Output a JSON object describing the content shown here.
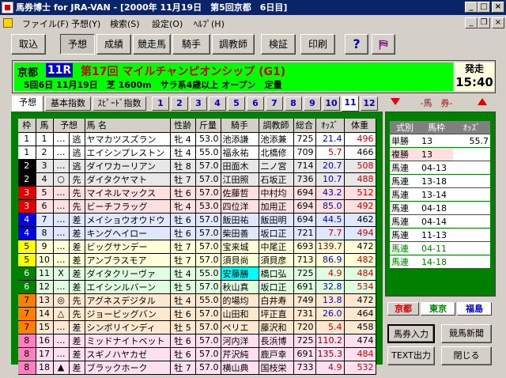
{
  "window": {
    "title": "馬券博士 for JRA-VAN - [2000年 11月19日　第5回京都　6日目]"
  },
  "menu": [
    "ファイル(F)",
    "予想(Y)",
    "検索(S)",
    "設定(O)",
    "ﾍﾙﾌﾟ(H)"
  ],
  "toolbar": [
    "取込",
    "予想",
    "成績",
    "競走馬",
    "騎手",
    "調教師",
    "検証",
    "印刷"
  ],
  "race": {
    "venue": "京都",
    "number": "11R",
    "name": "第17回 マイルチャンピオンシップ (G1)",
    "conditions": "5回6日 11月19日　芝 1600m　サラ系4歳以上 オープン　定量",
    "post_label": "発走",
    "post_time": "15:40"
  },
  "tabs": [
    "予想",
    "基本指数",
    "ｽﾋﾟｰﾄﾞ指数"
  ],
  "race_tabs": [
    "1",
    "2",
    "3",
    "4",
    "5",
    "6",
    "7",
    "8",
    "9",
    "10",
    "11",
    "12"
  ],
  "columns": [
    "枠",
    "馬",
    "予想",
    "馬 名",
    "性齢",
    "斤量",
    "騎手",
    "調教師",
    "総合",
    "ｵｯｽﾞ",
    "体重"
  ],
  "horses": [
    {
      "waku": "1",
      "uma": "1",
      "mark": "…",
      "style": "逃",
      "name": "ヤマカツスズラン",
      "sex": "牝 4",
      "weight": "53.0",
      "jockey": "池添謙",
      "trainer": "池添兼",
      "score": "725",
      "odds": "21.4",
      "body": "496"
    },
    {
      "waku": "1",
      "uma": "2",
      "mark": "…",
      "style": "逃",
      "name": "エイシンプレストン",
      "sex": "牡 4",
      "weight": "55.0",
      "jockey": "福永祐",
      "trainer": "北橋修",
      "score": "709",
      "odds": "5.7",
      "body": "466"
    },
    {
      "waku": "2",
      "uma": "3",
      "mark": "…",
      "style": "逃",
      "name": "ダイワカーリアン",
      "sex": "牡 8",
      "weight": "57.0",
      "jockey": "田面木",
      "trainer": "二ノ宮",
      "score": "714",
      "odds": "20.7",
      "body": "508"
    },
    {
      "waku": "2",
      "uma": "4",
      "mark": "○",
      "style": "先",
      "name": "ダイタクヤマト",
      "sex": "牡 7",
      "weight": "57.0",
      "jockey": "江田照",
      "trainer": "石坂正",
      "score": "736",
      "odds": "10.7",
      "body": "488"
    },
    {
      "waku": "3",
      "uma": "5",
      "mark": "…",
      "style": "先",
      "name": "マイネルマックス",
      "sex": "牡 6",
      "weight": "57.0",
      "jockey": "佐藤哲",
      "trainer": "中村均",
      "score": "694",
      "odds": "43.2",
      "body": "512"
    },
    {
      "waku": "3",
      "uma": "6",
      "mark": "…",
      "style": "先",
      "name": "ビーチフラッグ",
      "sex": "牝 4",
      "weight": "53.0",
      "jockey": "四位洋",
      "trainer": "加用正",
      "score": "694",
      "odds": "85.0",
      "body": "492"
    },
    {
      "waku": "4",
      "uma": "7",
      "mark": "…",
      "style": "差",
      "name": "メイショウオウドウ",
      "sex": "牡 6",
      "weight": "57.0",
      "jockey": "飯田祐",
      "trainer": "飯田明",
      "score": "694",
      "odds": "44.5",
      "body": "462"
    },
    {
      "waku": "4",
      "uma": "8",
      "mark": "…",
      "style": "差",
      "name": "キングヘイロー",
      "sex": "牡 6",
      "weight": "57.0",
      "jockey": "柴田善",
      "trainer": "坂口正",
      "score": "721",
      "odds": "7.7",
      "body": "494"
    },
    {
      "waku": "5",
      "uma": "9",
      "mark": "…",
      "style": "差",
      "name": "ビッグサンデー",
      "sex": "牡 7",
      "weight": "57.0",
      "jockey": "宝来城",
      "trainer": "中尾正",
      "score": "693",
      "odds": "139.7",
      "body": "472"
    },
    {
      "waku": "5",
      "uma": "10",
      "mark": "…",
      "style": "差",
      "name": "アンブラスモア",
      "sex": "牡 7",
      "weight": "57.0",
      "jockey": "須貝尚",
      "trainer": "須貝彦",
      "score": "713",
      "odds": "86.9",
      "body": "482"
    },
    {
      "waku": "6",
      "uma": "11",
      "mark": "X",
      "style": "差",
      "name": "ダイタクリーヴァ",
      "sex": "牡 4",
      "weight": "55.0",
      "jockey": "安藤勝",
      "trainer": "橋口弘",
      "score": "725",
      "odds": "4.9",
      "body": "484"
    },
    {
      "waku": "6",
      "uma": "12",
      "mark": "…",
      "style": "差",
      "name": "エイシンルバーン",
      "sex": "牡 5",
      "weight": "57.0",
      "jockey": "秋山真",
      "trainer": "坂口正",
      "score": "691",
      "odds": "32.8",
      "body": "534"
    },
    {
      "waku": "7",
      "uma": "13",
      "mark": "◎",
      "style": "先",
      "name": "アグネスデジタル",
      "sex": "牡 4",
      "weight": "55.0",
      "jockey": "的場均",
      "trainer": "白井寿",
      "score": "749",
      "odds": "13.8",
      "body": "472"
    },
    {
      "waku": "7",
      "uma": "14",
      "mark": "△",
      "style": "先",
      "name": "ジョービッグバン",
      "sex": "牡 6",
      "weight": "57.0",
      "jockey": "山田和",
      "trainer": "坪正直",
      "score": "731",
      "odds": "26.0",
      "body": "464"
    },
    {
      "waku": "7",
      "uma": "15",
      "mark": "…",
      "style": "差",
      "name": "シンボリインディ",
      "sex": "牡 5",
      "weight": "57.0",
      "jockey": "ペリエ",
      "trainer": "藤沢和",
      "score": "720",
      "odds": "5.4",
      "body": "458"
    },
    {
      "waku": "8",
      "uma": "16",
      "mark": "…",
      "style": "差",
      "name": "ミッドナイトベット",
      "sex": "牡 6",
      "weight": "57.0",
      "jockey": "河内洋",
      "trainer": "長浜博",
      "score": "725",
      "odds": "110.2",
      "body": "474"
    },
    {
      "waku": "8",
      "uma": "17",
      "mark": "…",
      "style": "差",
      "name": "スギノハヤカゼ",
      "sex": "牡 6",
      "weight": "57.0",
      "jockey": "芹沢純",
      "trainer": "鹿戸幸",
      "score": "691",
      "odds": "135.3",
      "body": "484"
    },
    {
      "waku": "8",
      "uma": "18",
      "mark": "▲",
      "style": "差",
      "name": "ブラックホーク",
      "sex": "牡 7",
      "weight": "57.0",
      "jockey": "横山典",
      "trainer": "国枝栄",
      "score": "733",
      "odds": "4.9",
      "body": "532"
    }
  ],
  "bet": {
    "label": "-馬　券-",
    "columns": [
      "式別",
      "馬枠",
      "ｵｯｽﾞ"
    ],
    "rows": [
      {
        "type": "単勝",
        "combo": "13",
        "odds": "55.7"
      },
      {
        "type": "複勝",
        "combo": "13",
        "odds": ""
      },
      {
        "type": "馬連",
        "combo": "04-13",
        "odds": ""
      },
      {
        "type": "馬連",
        "combo": "13-18",
        "odds": ""
      },
      {
        "type": "馬連",
        "combo": "13-14",
        "odds": ""
      },
      {
        "type": "馬連",
        "combo": "04-18",
        "odds": ""
      },
      {
        "type": "馬連",
        "combo": "04-14",
        "odds": ""
      },
      {
        "type": "馬連",
        "combo": "11-13",
        "odds": ""
      },
      {
        "type": "馬連",
        "combo": "04-11",
        "odds": ""
      },
      {
        "type": "馬連",
        "combo": "14-18",
        "odds": ""
      }
    ]
  },
  "venues": [
    "京都",
    "東京",
    "福島"
  ],
  "actions": [
    "馬券入力",
    "競馬新聞",
    "TEXT出力",
    "閉じる"
  ]
}
